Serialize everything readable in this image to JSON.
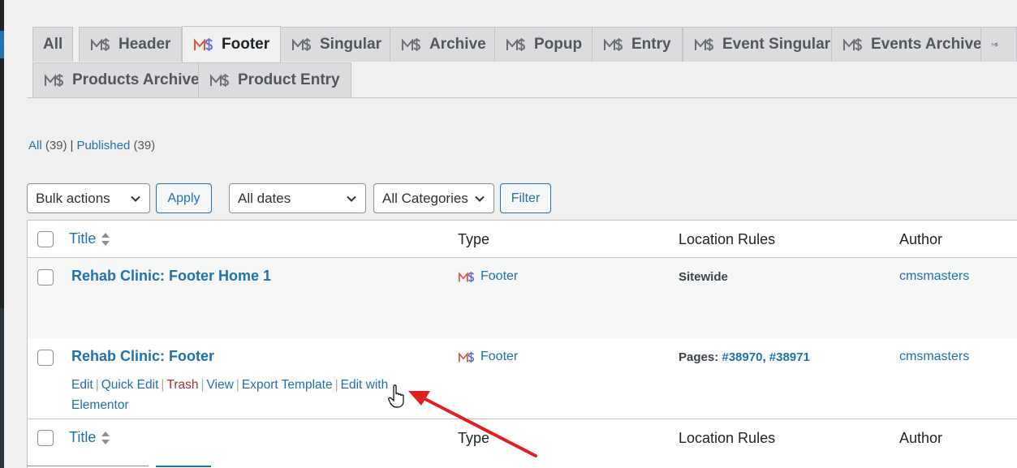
{
  "tabs": [
    {
      "label": "All",
      "icon": "",
      "active": false
    },
    {
      "label": "Header",
      "icon": "cmsmasters-logo-icon",
      "active": false
    },
    {
      "label": "Footer",
      "icon": "cmsmasters-logo-color-icon",
      "active": true
    },
    {
      "label": "Singular",
      "icon": "cmsmasters-logo-icon",
      "active": false
    },
    {
      "label": "Archive",
      "icon": "cmsmasters-logo-icon",
      "active": false
    },
    {
      "label": "Popup",
      "icon": "cmsmasters-logo-icon",
      "active": false
    },
    {
      "label": "Entry",
      "icon": "cmsmasters-logo-icon",
      "active": false
    },
    {
      "label": "Event Singular",
      "icon": "cmsmasters-logo-icon",
      "active": false
    },
    {
      "label": "Events Archive",
      "icon": "cmsmasters-logo-icon",
      "active": false
    },
    {
      "label": "Products Archive",
      "icon": "cmsmasters-logo-icon",
      "active": false
    },
    {
      "label": "Product Entry",
      "icon": "cmsmasters-logo-icon",
      "active": false
    }
  ],
  "views": {
    "all_label": "All",
    "all_count": "(39)",
    "separator": "|",
    "published_label": "Published",
    "published_count": "(39)"
  },
  "filters": {
    "bulk_actions": "Bulk actions",
    "apply": "Apply",
    "dates": "All dates",
    "categories": "All Categories",
    "filter": "Filter"
  },
  "columns": {
    "title": "Title",
    "type": "Type",
    "location": "Location Rules",
    "author": "Author"
  },
  "rows": [
    {
      "title": "Rehab Clinic: Footer Home 1",
      "type": "Footer",
      "location_label": "Sitewide",
      "author": "cmsmasters"
    },
    {
      "title": "Rehab Clinic: Footer",
      "type": "Footer",
      "location_label": "Pages:",
      "location_link1": "#38970",
      "location_comma": ",",
      "location_link2": "#38971",
      "author": "cmsmasters",
      "actions": {
        "edit": "Edit",
        "quick_edit": "Quick Edit",
        "trash": "Trash",
        "view": "View",
        "export": "Export Template",
        "edit_with_line1": "Edit with",
        "edit_with_line2": "Elementor",
        "separator": "|"
      }
    }
  ],
  "colors": {
    "link": "#2271b1",
    "trash": "#b32d2e",
    "annotation_arrow": "#e02020",
    "background": "#f0f0f1"
  }
}
